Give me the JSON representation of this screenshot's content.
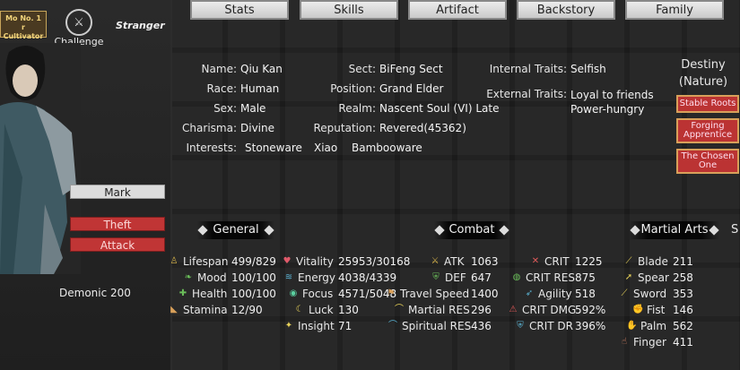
{
  "tabs": [
    "Stats",
    "Skills",
    "Artifact",
    "Backstory",
    "Family"
  ],
  "header": {
    "rank_badge": "Mo No. 1\nr Cultivator",
    "challenge_label": "Challenge",
    "stranger_label": "Stranger"
  },
  "left_panel": {
    "mark_label": "Mark",
    "theft_label": "Theft",
    "attack_label": "Attack",
    "demonic": "Demonic 200"
  },
  "profile": {
    "name_label": "Name:",
    "name": "Qiu Kan",
    "race_label": "Race:",
    "race": "Human",
    "sex_label": "Sex:",
    "sex": "Male",
    "charisma_label": "Charisma:",
    "charisma": "Divine",
    "interests_label": "Interests:",
    "interests": [
      "Stoneware",
      "Xiao",
      "Bambooware"
    ],
    "sect_label": "Sect:",
    "sect": "BiFeng Sect",
    "position_label": "Position:",
    "position": "Grand Elder",
    "realm_label": "Realm:",
    "realm": "Nascent Soul (VI) Late",
    "reputation_label": "Reputation:",
    "reputation": "Revered(45362)",
    "internal_traits_label": "Internal Traits:",
    "internal_traits": "Selfish",
    "external_traits_label": "External Traits:",
    "external_traits": [
      "Loyal to friends",
      "Power-hungry"
    ]
  },
  "destiny": {
    "title": "Destiny",
    "subtitle": "(Nature)",
    "items": [
      "Stable Roots",
      "Forging Apprentice",
      "The Chosen One"
    ]
  },
  "sections": {
    "general": "General",
    "combat": "Combat",
    "martial_arts": "Martial Arts",
    "cutoff": "S"
  },
  "general": [
    {
      "name": "Lifespan",
      "value": "499/829",
      "icon": "lifespan-icon"
    },
    {
      "name": "Mood",
      "value": "100/100",
      "icon": "mood-icon"
    },
    {
      "name": "Health",
      "value": "100/100",
      "icon": "health-icon"
    },
    {
      "name": "Stamina",
      "value": "12/90",
      "icon": "stamina-icon"
    }
  ],
  "vitals": [
    {
      "name": "Vitality",
      "value": "25953/30168",
      "icon": "heart-icon"
    },
    {
      "name": "Energy",
      "value": "4038/4339",
      "icon": "energy-icon"
    },
    {
      "name": "Focus",
      "value": "4571/5048",
      "icon": "eye-icon"
    },
    {
      "name": "Luck",
      "value": "130",
      "icon": "moon-icon"
    },
    {
      "name": "Insight",
      "value": "71",
      "icon": "star-icon"
    }
  ],
  "combat": [
    {
      "name": "ATK",
      "value": "1063",
      "icon": "swords-icon"
    },
    {
      "name": "DEF",
      "value": "647",
      "icon": "shield-icon"
    },
    {
      "name": "Travel Speed",
      "value": "1400",
      "icon": "boot-icon"
    },
    {
      "name": "Martial RES",
      "value": "296",
      "icon": "martial-res-icon"
    },
    {
      "name": "Spiritual RES",
      "value": "436",
      "icon": "spiritual-res-icon"
    }
  ],
  "crit": [
    {
      "name": "CRIT",
      "value": "1225",
      "icon": "crit-icon"
    },
    {
      "name": "CRIT RES",
      "value": "875",
      "icon": "crit-res-icon"
    },
    {
      "name": "Agility",
      "value": "518",
      "icon": "agility-icon"
    },
    {
      "name": "CRIT DMG",
      "value": "592%",
      "icon": "crit-dmg-icon"
    },
    {
      "name": "CRIT DR",
      "value": "396%",
      "icon": "crit-dr-icon"
    }
  ],
  "martial_arts": [
    {
      "name": "Blade",
      "value": "211",
      "icon": "blade-icon"
    },
    {
      "name": "Spear",
      "value": "258",
      "icon": "spear-icon"
    },
    {
      "name": "Sword",
      "value": "353",
      "icon": "sword-icon"
    },
    {
      "name": "Fist",
      "value": "146",
      "icon": "fist-icon"
    },
    {
      "name": "Palm",
      "value": "562",
      "icon": "palm-icon"
    },
    {
      "name": "Finger",
      "value": "411",
      "icon": "finger-icon"
    }
  ]
}
